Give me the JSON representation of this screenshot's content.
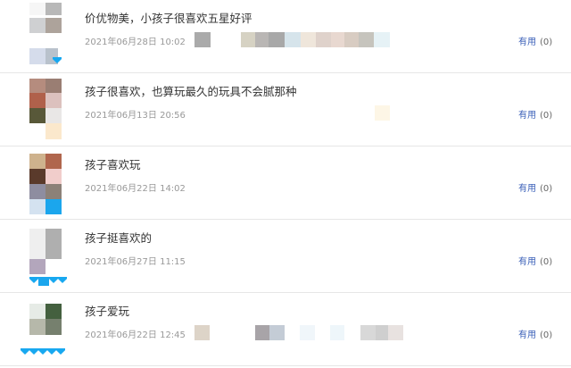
{
  "reviews": [
    {
      "content": "价优物美，小孩子很喜欢五星好评",
      "datetime": "2021年06月28日 10:02",
      "helpful_label": "有用",
      "helpful_count": "(0)",
      "colors": [
        "#cfd0d2",
        "#ada39b",
        "#d5dceb",
        "#b9c2cc",
        "#18a8f0"
      ],
      "image_colors": [
        "#aaaaaa",
        "#d6d2c3",
        "#b9b6b4",
        "#a8a8a8",
        "#d6e4eb",
        "#efe6db",
        "#dfd2cb",
        "#e8d8d0",
        "#d8ccc2",
        "#c6c4bd",
        "#e6f2f6"
      ]
    },
    {
      "content": "孩子很喜欢，也算玩最久的玩具不会腻那种",
      "datetime": "2021年06月13日 20:56",
      "helpful_label": "有用",
      "helpful_count": "(0)",
      "colors": [
        "#b58c7e",
        "#9a7e73",
        "#b0614b",
        "#dcc1be",
        "#585839",
        "#e9e7e6",
        "#fbe8cc"
      ],
      "image_colors": [
        "#fdf6e6"
      ]
    },
    {
      "content": "孩子喜欢玩",
      "datetime": "2021年06月22日 14:02",
      "helpful_label": "有用",
      "helpful_count": "(0)",
      "colors": [
        "#ceb28d",
        "#b0664d",
        "#5a3a2b",
        "#f1cdcb",
        "#8e8da0",
        "#8c8178",
        "#d4e2f0",
        "#1ba6ed"
      ],
      "image_colors": []
    },
    {
      "content": "孩子挺喜欢的",
      "datetime": "2021年06月27日 11:15",
      "helpful_label": "有用",
      "helpful_count": "(0)",
      "colors": [
        "#efefef",
        "#afafaf",
        "#b3a6bc",
        "#1ba6ed"
      ],
      "image_colors": []
    },
    {
      "content": "孩子爱玩",
      "datetime": "2021年06月22日 12:45",
      "helpful_label": "有用",
      "helpful_count": "(0)",
      "colors": [
        "#e6ebe6",
        "#44603f",
        "#b6b8aa",
        "#76806e",
        "#1ba6ed"
      ],
      "image_colors": [
        "#ddd4c8",
        "#a8a4a8",
        "#c4ccd6",
        "#f0f6fa",
        "#eef6fa",
        "#d8d8d8",
        "#cfcfcf",
        "#e8e2e0"
      ]
    }
  ]
}
